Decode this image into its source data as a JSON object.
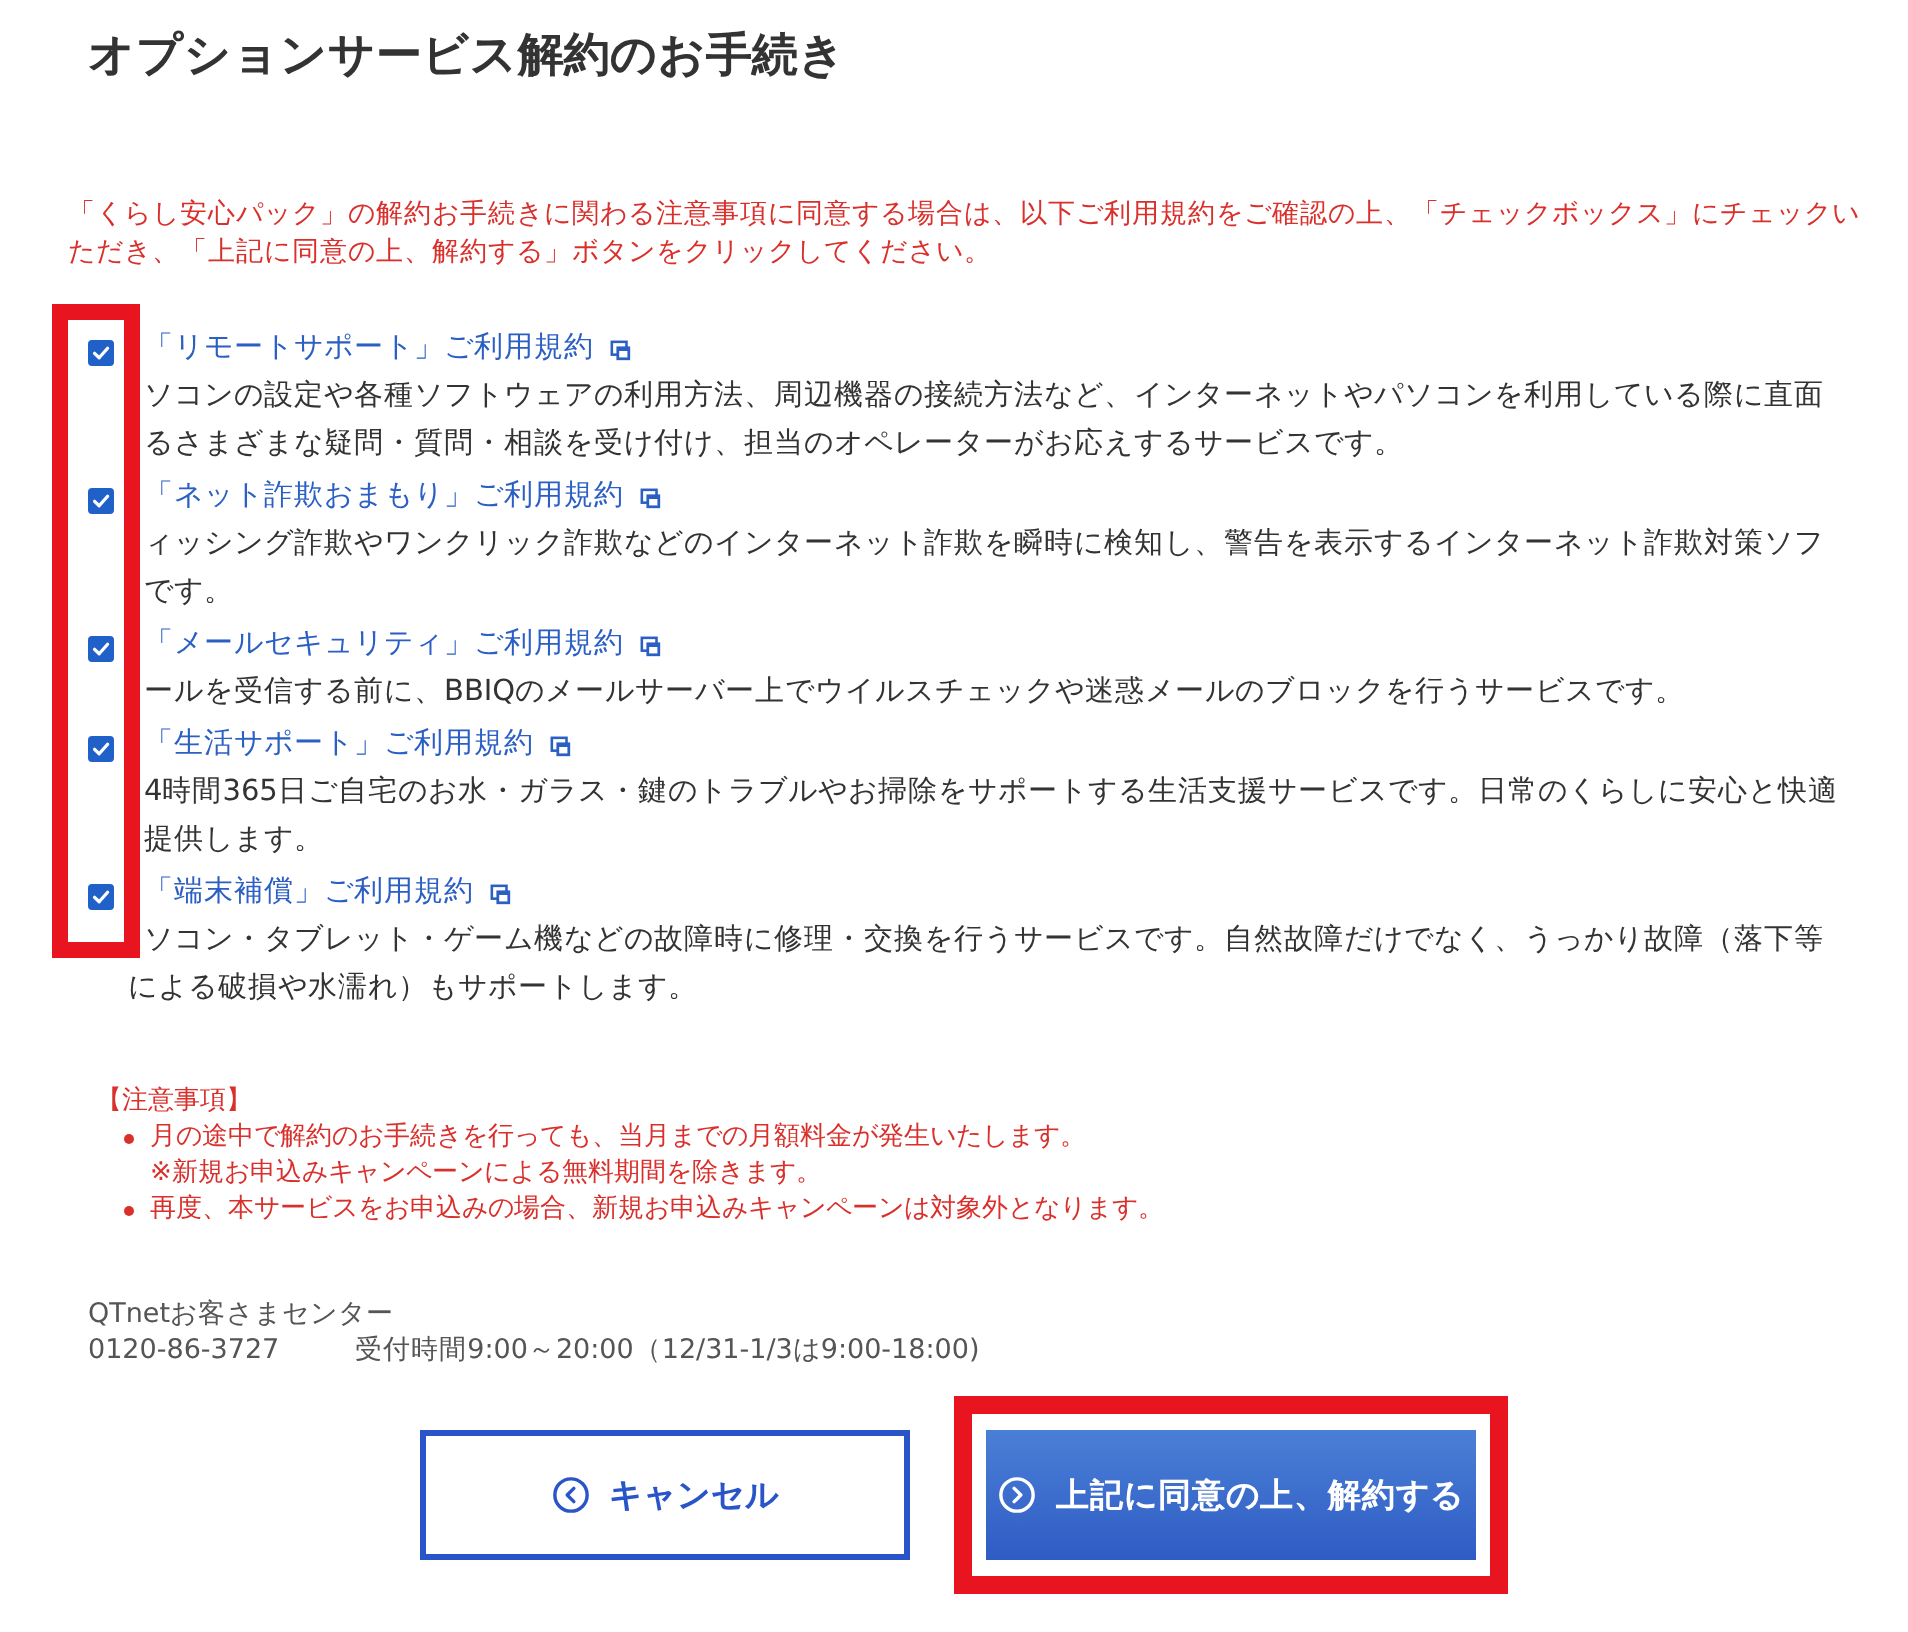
{
  "title": "オプションサービス解約のお手続き",
  "instruction": "「くらし安心パック」の解約お手続きに関わる注意事項に同意する場合は、以下ご利用規約をご確認の上、「チェックボックス」にチェックいただき、「上記に同意の上、解約する」ボタンをクリックしてください。",
  "terms_highlighted": true,
  "terms": [
    {
      "label": "「リモートサポート」ご利用規約",
      "checked": true,
      "description_lines": [
        "ソコンの設定や各種ソフトウェアの利用方法、周辺機器の接続方法など、インターネットやパソコンを利用している際に直面",
        "るさまざまな疑問・質問・相談を受け付け、担当のオペレーターがお応えするサービスです。"
      ]
    },
    {
      "label": "「ネット詐欺おまもり」ご利用規約",
      "checked": true,
      "description_lines": [
        "ィッシング詐欺やワンクリック詐欺などのインターネット詐欺を瞬時に検知し、警告を表示するインターネット詐欺対策ソフ",
        "です。"
      ]
    },
    {
      "label": "「メールセキュリティ」ご利用規約",
      "checked": true,
      "description_lines": [
        "ールを受信する前に、BBIQのメールサーバー上でウイルスチェックや迷惑メールのブロックを行うサービスです。"
      ]
    },
    {
      "label": "「生活サポート」ご利用規約",
      "checked": true,
      "description_lines": [
        "4時間365日ご自宅のお水・ガラス・鍵のトラブルやお掃除をサポートする生活支援サービスです。日常のくらしに安心と快適",
        "提供します。"
      ]
    },
    {
      "label": "「端末補償」ご利用規約",
      "checked": true,
      "description_lines": [
        "ソコン・タブレット・ゲーム機などの故障時に修理・交換を行うサービスです。自然故障だけでなく、うっかり故障（落下等",
        "による破損や水濡れ）もサポートします。"
      ]
    }
  ],
  "notes": {
    "heading": "【注意事項】",
    "items": [
      {
        "text": "月の途中で解約のお手続きを行っても、当月までの月額料金が発生いたします。",
        "sub": "※新規お申込みキャンペーンによる無料期間を除きます。"
      },
      {
        "text": "再度、本サービスをお申込みの場合、新規お申込みキャンペーンは対象外となります。"
      }
    ]
  },
  "contact": {
    "name": "QTnetお客さまセンター",
    "phone": "0120-86-3727",
    "hours": "受付時間9:00～20:00（12/31-1/3は9:00-18:00)"
  },
  "buttons": [
    {
      "label": "キャンセル",
      "kind": "secondary",
      "highlighted": false
    },
    {
      "label": "上記に同意の上、解約する",
      "kind": "primary",
      "highlighted": true
    }
  ]
}
